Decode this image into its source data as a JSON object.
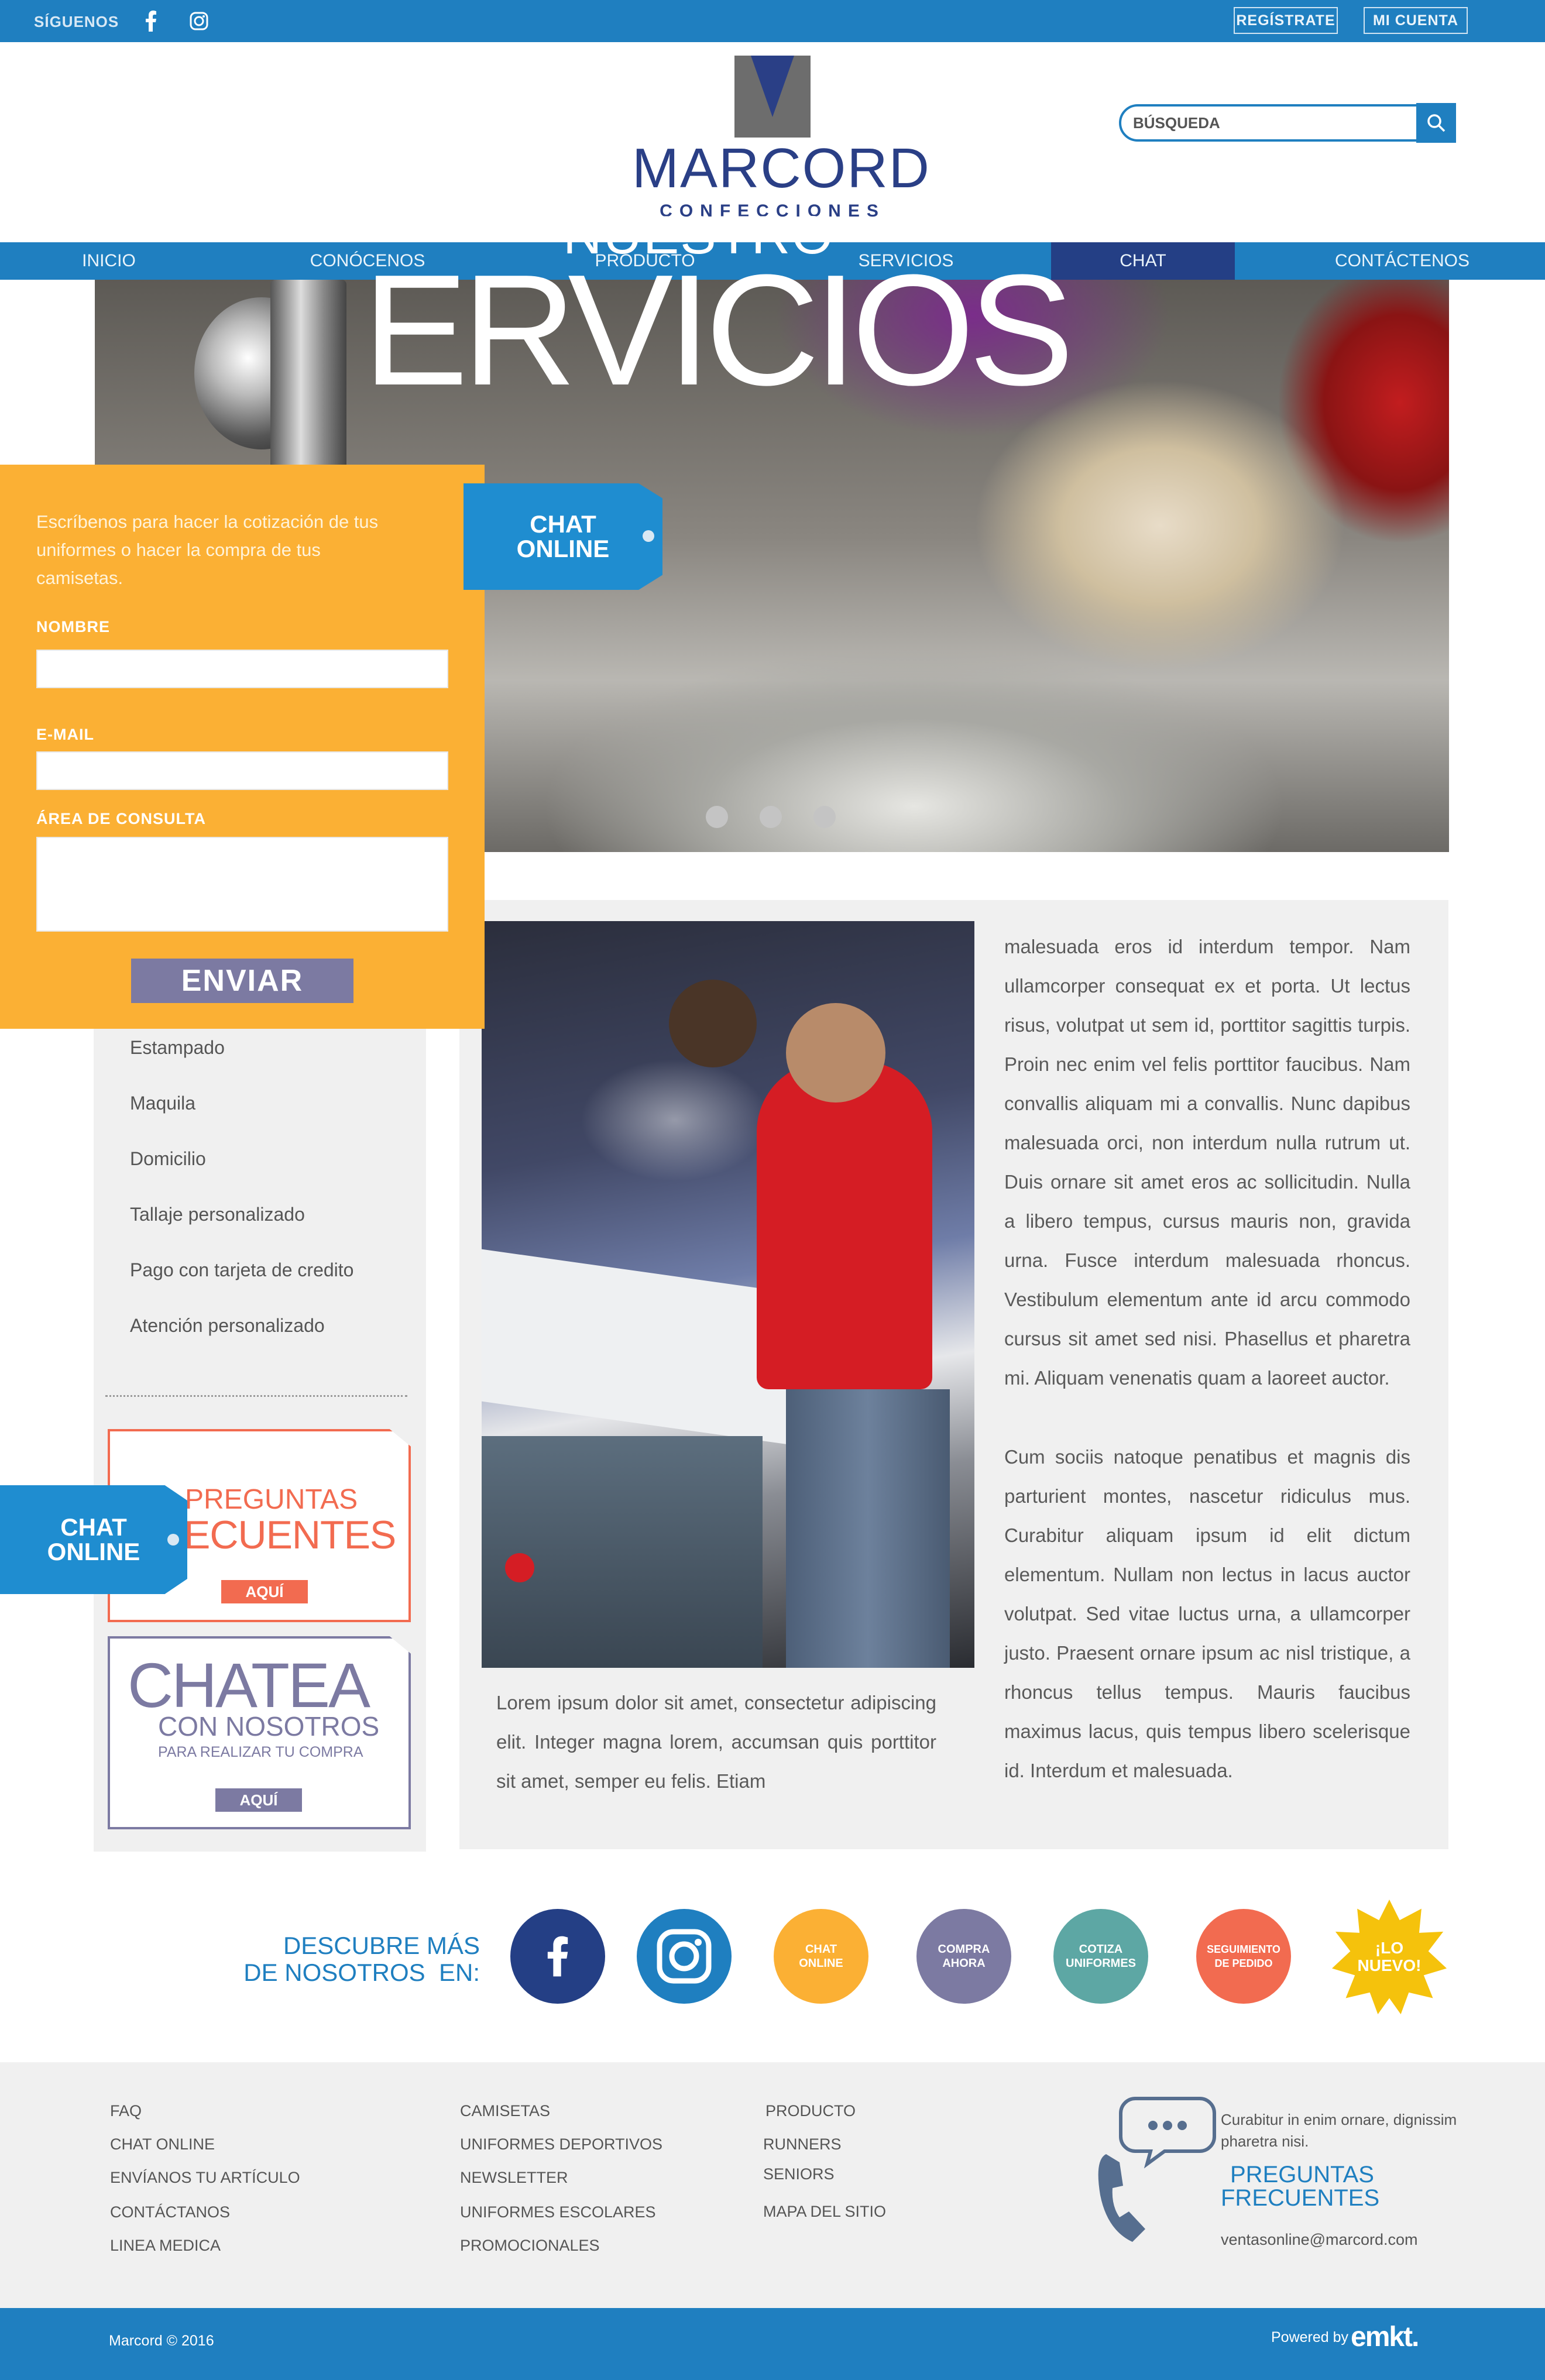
{
  "topbar": {
    "follow_label": "SÍGUENOS",
    "social_icons": [
      "facebook-icon",
      "instagram-icon"
    ],
    "register_label": "REGÍSTRATE",
    "account_label": "MI CUENTA"
  },
  "header": {
    "logo_title": "MARCORD",
    "logo_subtitle": "CONFECCIONES",
    "search_placeholder": "BÚSQUEDA"
  },
  "nav": {
    "items": [
      {
        "label": "INICIO"
      },
      {
        "label": "CONÓCENOS"
      },
      {
        "label": "PRODUCTO"
      },
      {
        "label": "SERVICIOS"
      },
      {
        "label": "CHAT",
        "active": true
      },
      {
        "label": "CONTÁCTENOS"
      }
    ]
  },
  "hero": {
    "subtitle": "NUESTRO",
    "title": "ERVICIOS",
    "slides": 3
  },
  "chat_form": {
    "intro": "Escríbenos para hacer la cotización de tus uniformes o hacer la compra de tus camisetas.",
    "name_label": "NOMBRE",
    "email_label": "E-MAIL",
    "query_label": "ÁREA DE CONSULTA",
    "send_label": "ENVIAR",
    "tab_label_line1": "CHAT",
    "tab_label_line2": "ONLINE"
  },
  "sidebar": {
    "items": [
      "Estampado",
      "Maquila",
      "Domicilio",
      "Tallaje personalizado",
      "Pago con tarjeta de credito",
      "Atención personalizado"
    ],
    "faq_promo": {
      "line1": "PREGUNTAS",
      "line2": "ECUENTES",
      "button": "AQUÍ"
    },
    "chat_promo": {
      "line1": "CHATEA",
      "line2": "CON NOSOTROS",
      "line3": "PARA REALIZAR TU COMPRA",
      "button": "AQUÍ"
    },
    "chat_tab_line1": "CHAT",
    "chat_tab_line2": "ONLINE"
  },
  "content": {
    "caption": "Lorem ipsum dolor sit amet, consectetur adipiscing elit. Integer magna lorem, accumsan quis porttitor sit amet, semper eu felis. Etiam",
    "paragraph1": "malesuada eros id interdum tempor. Nam ullamcorper consequat ex et porta. Ut lectus risus, volutpat ut sem id, porttitor sagittis turpis. Proin nec enim vel felis porttitor faucibus. Nam convallis aliquam mi a convallis. Nunc dapibus malesuada orci, non interdum nulla rutrum ut. Duis ornare sit amet eros ac sollicitudin. Nulla a libero tempus, cursus mauris non, gravida urna. Fusce interdum malesuada rhoncus. Vestibulum elementum ante id arcu commodo cursus sit amet sed nisi. Phasellus et pharetra mi. Aliquam venenatis quam a laoreet auctor.",
    "paragraph2": "Cum sociis natoque penatibus et magnis dis parturient montes, nascetur ridiculus mus. Curabitur aliquam ipsum id elit dictum elementum. Nullam non lectus in lacus auctor volutpat. Sed vitae luctus urna, a ullamcorper justo. Praesent ornare ipsum ac nisl tristique, a rhoncus tellus tempus. Mauris faucibus maximus lacus, quis tempus libero scelerisque id. Interdum et malesuada."
  },
  "discover": {
    "line1": "DESCUBRE MÁS",
    "line2": "DE NOSOTROS  EN:",
    "circles": [
      {
        "label1": "CHAT",
        "label2": "ONLINE",
        "color": "#fbb034"
      },
      {
        "label1": "COMPRA",
        "label2": "AHORA",
        "color": "#7c7aa2"
      },
      {
        "label1": "COTIZA",
        "label2": "UNIFORMES",
        "color": "#5da7a4"
      },
      {
        "label1": "SEGUIMIENTO",
        "label2": "DE PEDIDO",
        "color": "#f26b50"
      }
    ],
    "new_badge": {
      "line1": "¡LO",
      "line2": "NUEVO!"
    },
    "facebook_color": "#243f85",
    "instagram_color": "#1f7fc0"
  },
  "footer": {
    "col1": [
      "FAQ",
      "CHAT ONLINE",
      "ENVÍANOS TU ARTÍCULO",
      "CONTÁCTANOS",
      "LINEA MEDICA"
    ],
    "col2": [
      "CAMISETAS",
      "UNIFORMES DEPORTIVOS",
      "NEWSLETTER",
      "UNIFORMES ESCOLARES",
      "PROMOCIONALES"
    ],
    "col3": [
      "PRODUCTO",
      "RUNNERS",
      "SENIORS",
      "MAPA DEL SITIO"
    ],
    "callout_text": "Curabitur in enim ornare, dignissim pharetra nisi.",
    "faq_line1": "PREGUNTAS",
    "faq_line2": "FRECUENTES",
    "email": "ventasonline@marcord.com",
    "copyright": "Marcord © 2016",
    "powered_by": "Powered by",
    "powered_brand": "emkt."
  },
  "colors": {
    "primary_blue": "#1f7fc0",
    "dark_blue": "#243f85",
    "orange": "#fbb034",
    "coral": "#f26b50",
    "lavender": "#7c7aa2"
  }
}
